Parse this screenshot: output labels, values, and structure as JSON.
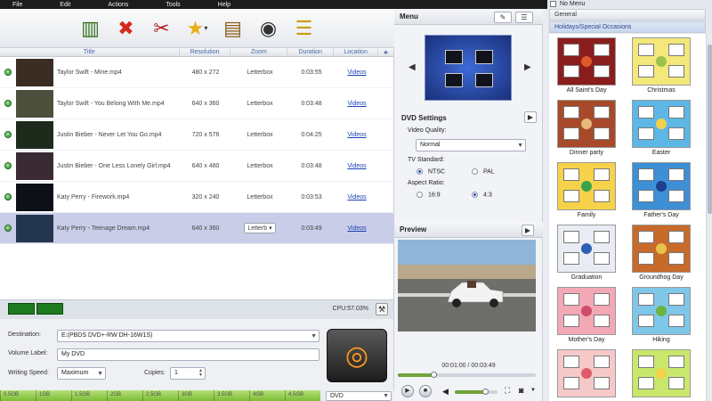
{
  "menubar": [
    "File",
    "Edit",
    "Actions",
    "Tools",
    "Help"
  ],
  "toolbar": [
    {
      "name": "add-video-icon",
      "glyph": "▥"
    },
    {
      "name": "delete-icon",
      "glyph": "✖"
    },
    {
      "name": "cut-icon",
      "glyph": "✂"
    },
    {
      "name": "effects-star-icon",
      "glyph": "★"
    },
    {
      "name": "subtitle-icon",
      "glyph": "▤"
    },
    {
      "name": "disc-icon",
      "glyph": "◉"
    },
    {
      "name": "chapter-list-icon",
      "glyph": "☰"
    }
  ],
  "table": {
    "columns": [
      "Title",
      "Resolution",
      "Zoom",
      "Duration",
      "Location",
      "★"
    ],
    "rows": [
      {
        "title": "Taylor Swift - Mine.mp4",
        "resolution": "480 x 272",
        "zoom": "Letterbox",
        "duration": "0:03:55",
        "location": "Videos",
        "thumb": "#3b2d24"
      },
      {
        "title": "Taylor Swift - You Belong With Me.mp4",
        "resolution": "640 x 360",
        "zoom": "Letterbox",
        "duration": "0:03:48",
        "location": "Videos",
        "thumb": "#4b4f3c"
      },
      {
        "title": "Justin Bieber - Never Let You Go.mp4",
        "resolution": "720 x 576",
        "zoom": "Letterbox",
        "duration": "0:04:25",
        "location": "Videos",
        "thumb": "#1e2a1c"
      },
      {
        "title": "Justin Bieber - One Less Lonely Girl.mp4",
        "resolution": "640 x 480",
        "zoom": "Letterbox",
        "duration": "0:03:48",
        "location": "Videos",
        "thumb": "#3a2a33"
      },
      {
        "title": "Katy Perry - Firework.mp4",
        "resolution": "320 x 240",
        "zoom": "Letterbox",
        "duration": "0:03:53",
        "location": "Videos",
        "thumb": "#0d1016"
      },
      {
        "title": "Katy Perry - Teenage Dream.mp4",
        "resolution": "640 x 360",
        "zoom": "Letterb",
        "duration": "0:03:49",
        "location": "Videos",
        "thumb": "#24364d",
        "selected": true
      }
    ]
  },
  "status": {
    "cpu": "CPU:57.03%"
  },
  "dest": {
    "destination_label": "Destination:",
    "destination_value": "E:(PBDS DVD+-RW DH-16W1S)",
    "volume_label": "Volume Label:",
    "volume_value": "My DVD",
    "speed_label": "Writing Speed:",
    "speed_value": "Maximum",
    "copies_label": "Copies:",
    "copies_value": "1"
  },
  "capacity": {
    "ticks": [
      "0.5GB",
      "1GB",
      "1.5GB",
      "2GB",
      "2.5GB",
      "3GB",
      "3.5GB",
      "4GB",
      "4.5GB"
    ],
    "disc_type": "DVD"
  },
  "menu_panel": {
    "title": "Menu"
  },
  "dvd_settings": {
    "title": "DVD Settings",
    "quality_label": "Video Quality:",
    "quality_value": "Normal",
    "tv_label": "TV Standard:",
    "ntsc": "NTSC",
    "pal": "PAL",
    "aspect_label": "Aspect Ratio:",
    "ar169": "16:9",
    "ar43": "4:3"
  },
  "preview": {
    "title": "Preview",
    "timecode": "00:01:00 / 00:03:49",
    "progress_fraction": 0.26,
    "volume_fraction": 0.7
  },
  "templates": {
    "no_menu": "No Menu",
    "general": "General",
    "category": "Holidays/Special Occasions",
    "items": [
      {
        "name": "All Saint's Day",
        "bg": "#8c1d1d",
        "accent": "#e05b2b"
      },
      {
        "name": "Christmas",
        "bg": "#f4e87a",
        "accent": "#9bc24c"
      },
      {
        "name": "Dinner party",
        "bg": "#a84a2a",
        "accent": "#e6b97a"
      },
      {
        "name": "Easter",
        "bg": "#5cb7e6",
        "accent": "#f2d14b"
      },
      {
        "name": "Family",
        "bg": "#f6d24a",
        "accent": "#3aa34a"
      },
      {
        "name": "Father's Day",
        "bg": "#3d8fd6",
        "accent": "#1f3f8f"
      },
      {
        "name": "Graduation",
        "bg": "#e9ecf2",
        "accent": "#2f5fb3"
      },
      {
        "name": "Groundhog Day",
        "bg": "#c86a2a",
        "accent": "#e6c34a"
      },
      {
        "name": "Mother's Day",
        "bg": "#f3a9b5",
        "accent": "#d04a6a"
      },
      {
        "name": "Hiking",
        "bg": "#7fc7e8",
        "accent": "#6db33f"
      },
      {
        "name": "",
        "bg": "#f6c9c9",
        "accent": "#e05b6b"
      },
      {
        "name": "",
        "bg": "#c9e86b",
        "accent": "#f2d14b"
      }
    ]
  }
}
